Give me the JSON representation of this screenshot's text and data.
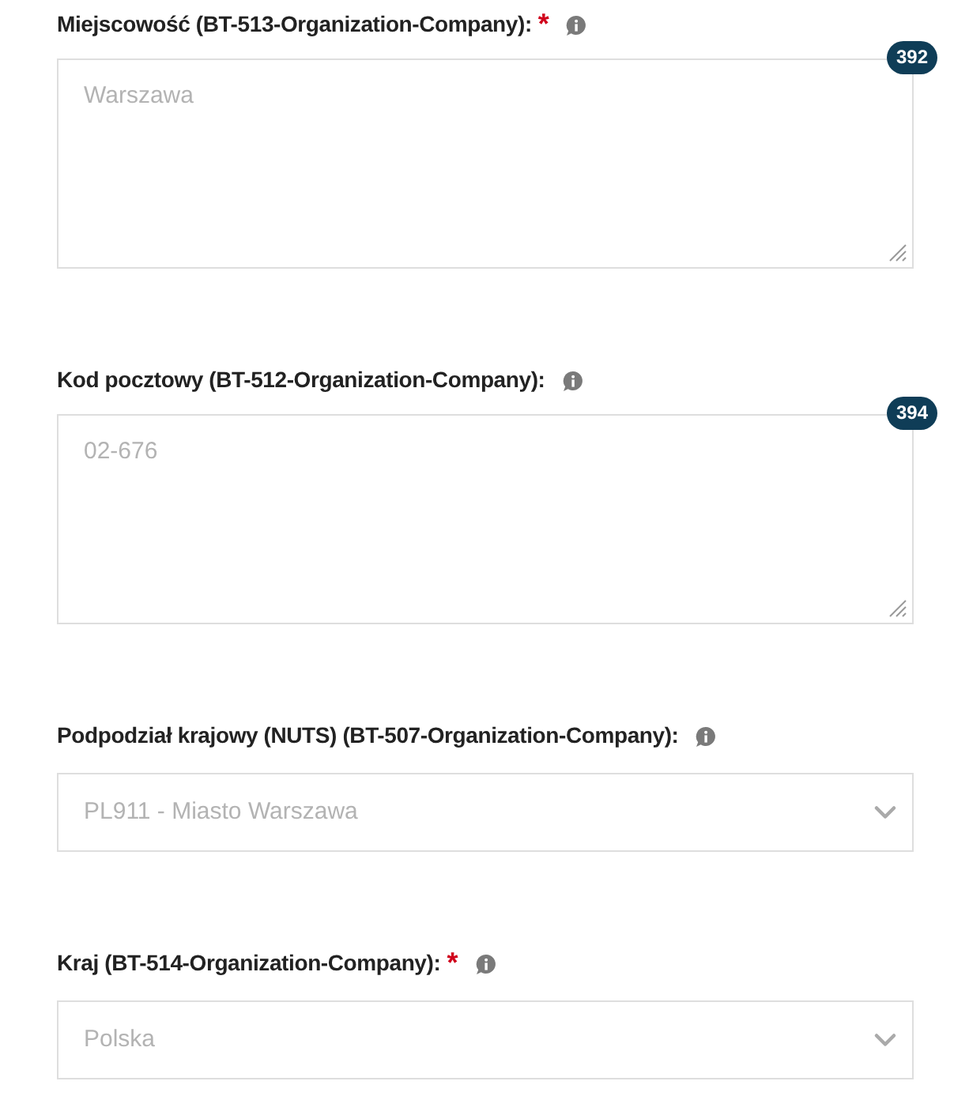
{
  "fields": [
    {
      "kind": "textarea",
      "label": "Miejscowość (BT-513-Organization-Company):",
      "required_mark": "*",
      "value": "Warszawa",
      "disabled": true,
      "counter": "392"
    },
    {
      "kind": "textarea",
      "label": "Kod pocztowy (BT-512-Organization-Company):",
      "value": "02-676",
      "disabled": true,
      "counter": "394"
    },
    {
      "kind": "select",
      "label": "Podpodział krajowy (NUTS) (BT-507-Organization-Company):",
      "value": "PL911 - Miasto Warszawa",
      "disabled": true
    },
    {
      "kind": "select",
      "label": "Kraj (BT-514-Organization-Company):",
      "required_mark": "*",
      "value": "Polska",
      "disabled": true
    }
  ]
}
